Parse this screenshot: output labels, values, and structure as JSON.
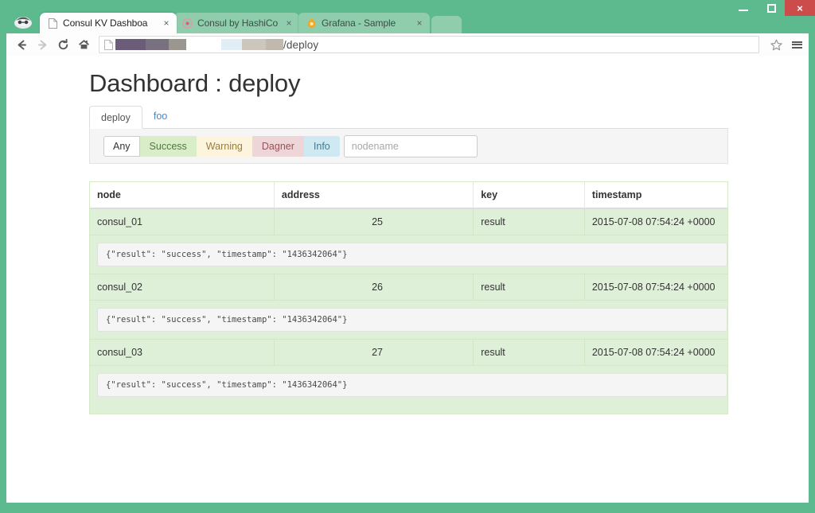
{
  "window": {
    "controls": {
      "minimize_label": "Minimize",
      "maximize_label": "Maximize",
      "close_label": "×"
    },
    "frame_color": "#5cba8e",
    "close_color": "#cc4c4c"
  },
  "browser": {
    "tabs": [
      {
        "title": "Consul KV Dashboa",
        "favicon": "page-icon",
        "active": true,
        "close_label": "×"
      },
      {
        "title": "Consul by HashiCo",
        "favicon": "consul-icon",
        "active": false,
        "close_label": "×"
      },
      {
        "title": "Grafana - Sample",
        "favicon": "grafana-icon",
        "active": false,
        "close_label": "×"
      }
    ],
    "new_tab_label": "",
    "toolbar": {
      "back_label": "←",
      "forward_label": "→",
      "reload_label": "⟳",
      "home_label": "⌂",
      "star_label": "☆",
      "menu_label": "≡"
    },
    "omnibox": {
      "url_suffix": "/deploy",
      "redacted": true
    }
  },
  "page": {
    "title": "Dashboard : deploy",
    "tabs": [
      {
        "label": "deploy",
        "active": true
      },
      {
        "label": "foo",
        "active": false
      }
    ],
    "filters": [
      {
        "label": "Any",
        "style": "any"
      },
      {
        "label": "Success",
        "style": "success"
      },
      {
        "label": "Warning",
        "style": "warning"
      },
      {
        "label": "Dagner",
        "style": "danger"
      },
      {
        "label": "Info",
        "style": "info"
      }
    ],
    "search": {
      "placeholder": "nodename",
      "value": ""
    },
    "table": {
      "columns": [
        "node",
        "address",
        "key",
        "timestamp"
      ],
      "rows": [
        {
          "node": "consul_01",
          "address": "25",
          "key": "result",
          "timestamp": "2015-07-08 07:54:24 +0000",
          "detail": "{\"result\": \"success\", \"timestamp\": \"1436342064\"}"
        },
        {
          "node": "consul_02",
          "address": "26",
          "key": "result",
          "timestamp": "2015-07-08 07:54:24 +0000",
          "detail": "{\"result\": \"success\", \"timestamp\": \"1436342064\"}"
        },
        {
          "node": "consul_03",
          "address": "27",
          "key": "result",
          "timestamp": "2015-07-08 07:54:24 +0000",
          "detail": "{\"result\": \"success\", \"timestamp\": \"1436342064\"}"
        }
      ]
    }
  }
}
